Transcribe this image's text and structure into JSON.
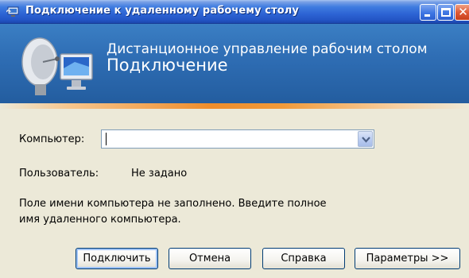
{
  "window": {
    "title": "Подключение к удаленному рабочему столу",
    "titlebar_color": "#2456c6"
  },
  "banner": {
    "line1": "Дистанционное управление рабочим столом",
    "line2": "Подключение",
    "icon": "remote-desktop-monitor-icon"
  },
  "form": {
    "computer_label": "Компьютер:",
    "computer_value": "",
    "user_label": "Пользователь:",
    "user_value": "Не задано",
    "message_line1": "Поле имени компьютера не заполнено. Введите полное",
    "message_line2": "имя удаленного компьютера."
  },
  "buttons": {
    "connect": "Подключить",
    "cancel": "Отмена",
    "help": "Справка",
    "options": "Параметры >>"
  },
  "colors": {
    "accent": "#ee8d2c",
    "dialog_bg": "#ece9d8",
    "banner_bg": "#2f6eb5"
  }
}
